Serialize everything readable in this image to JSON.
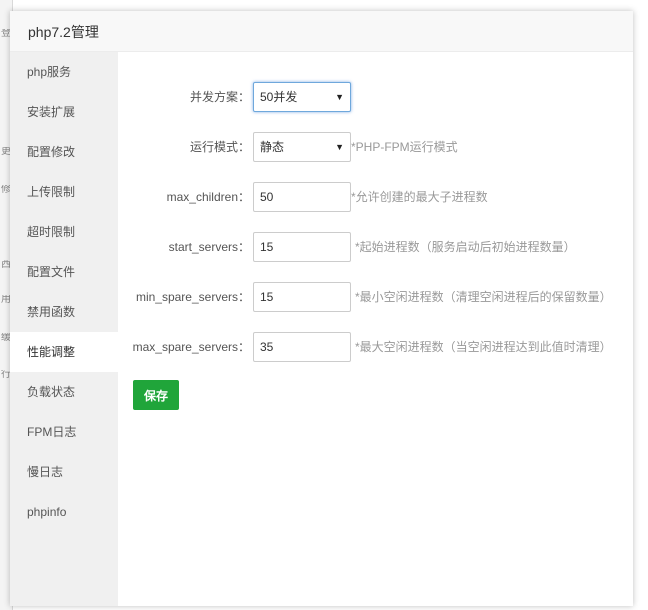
{
  "dialog": {
    "title": "php7.2管理"
  },
  "sidebar": {
    "items": [
      {
        "label": "php服务"
      },
      {
        "label": "安装扩展"
      },
      {
        "label": "配置修改"
      },
      {
        "label": "上传限制"
      },
      {
        "label": "超时限制"
      },
      {
        "label": "配置文件"
      },
      {
        "label": "禁用函数"
      },
      {
        "label": "性能调整",
        "active": true
      },
      {
        "label": "负载状态"
      },
      {
        "label": "FPM日志"
      },
      {
        "label": "慢日志"
      },
      {
        "label": "phpinfo"
      }
    ]
  },
  "background": {
    "glyphs": [
      "登",
      "更",
      "修",
      "西",
      "用",
      "缓",
      "行"
    ]
  },
  "form": {
    "concurrency": {
      "label": "并发方案：",
      "value": "50并发"
    },
    "run_mode": {
      "label": "运行模式：",
      "value": "静态",
      "hint": "*PHP-FPM运行模式"
    },
    "max_children": {
      "label": "max_children：",
      "value": "50",
      "hint": "*允许创建的最大子进程数"
    },
    "start_servers": {
      "label": "start_servers：",
      "value": "15",
      "hint": "*起始进程数（服务启动后初始进程数量）"
    },
    "min_spare_servers": {
      "label": "min_spare_servers：",
      "value": "15",
      "hint": "*最小空闲进程数（清理空闲进程后的保留数量）"
    },
    "max_spare_servers": {
      "label": "max_spare_servers：",
      "value": "35",
      "hint": "*最大空闲进程数（当空闲进程达到此值时清理）"
    },
    "save_label": "保存"
  }
}
